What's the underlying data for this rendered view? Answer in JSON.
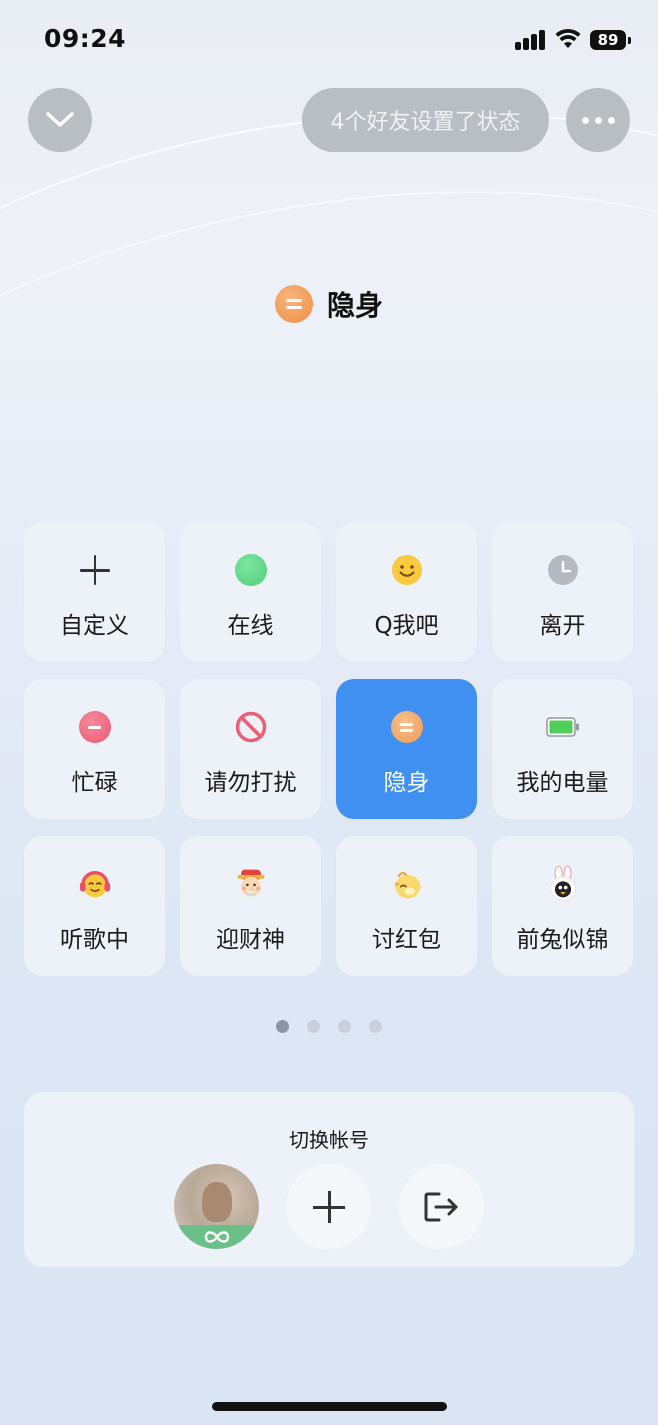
{
  "status_bar": {
    "time": "09:24",
    "battery": "89"
  },
  "header": {
    "friends_status": "4个好友设置了状态"
  },
  "current_status": {
    "label": "隐身",
    "icon": "invisible-orb-icon"
  },
  "status_options": [
    {
      "label": "自定义",
      "icon": "plus-icon"
    },
    {
      "label": "在线",
      "icon": "online-green-dot-icon"
    },
    {
      "label": "Q我吧",
      "icon": "smiley-face-icon"
    },
    {
      "label": "离开",
      "icon": "clock-icon"
    },
    {
      "label": "忙碌",
      "icon": "busy-minus-icon"
    },
    {
      "label": "请勿打扰",
      "icon": "do-not-disturb-icon"
    },
    {
      "label": "隐身",
      "icon": "invisible-icon",
      "selected": true
    },
    {
      "label": "我的电量",
      "icon": "battery-icon"
    },
    {
      "label": "听歌中",
      "icon": "headphones-face-icon"
    },
    {
      "label": "迎财神",
      "icon": "god-of-wealth-icon"
    },
    {
      "label": "讨红包",
      "icon": "chick-icon"
    },
    {
      "label": "前兔似锦",
      "icon": "rabbit-penguin-icon"
    }
  ],
  "pagination": {
    "pages": 4,
    "current": 1
  },
  "account": {
    "title": "切换帐号"
  },
  "colors": {
    "accent": "#4090f2",
    "invisible": "#ef9a56",
    "online": "#4fcf78",
    "busy": "#e85a73"
  }
}
